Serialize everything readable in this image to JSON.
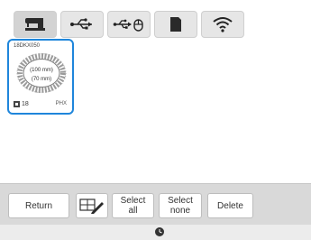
{
  "tabs": [
    {
      "name": "machine-memory",
      "icon": "sewing-machine-icon",
      "active": true
    },
    {
      "name": "usb-port-1",
      "icon": "usb-icon",
      "active": false
    },
    {
      "name": "usb-port-mouse",
      "icon": "usb-mouse-icon",
      "active": false
    },
    {
      "name": "sd-card",
      "icon": "sd-card-icon",
      "active": false
    },
    {
      "name": "wireless",
      "icon": "wifi-icon",
      "active": false
    }
  ],
  "thumbnail": {
    "id": "18DKX050",
    "size_line1": "(100 mm)",
    "size_line2": "(70 mm)",
    "color_count": "18",
    "format": "PHX",
    "selected": true
  },
  "bottombar": {
    "return_label": "Return",
    "select_all_label": "Select\nall",
    "select_none_label": "Select\nnone",
    "delete_label": "Delete"
  },
  "colors": {
    "selection": "#1f86db",
    "bar": "#d9d9d9",
    "tab_bg": "#e6e6e6"
  }
}
